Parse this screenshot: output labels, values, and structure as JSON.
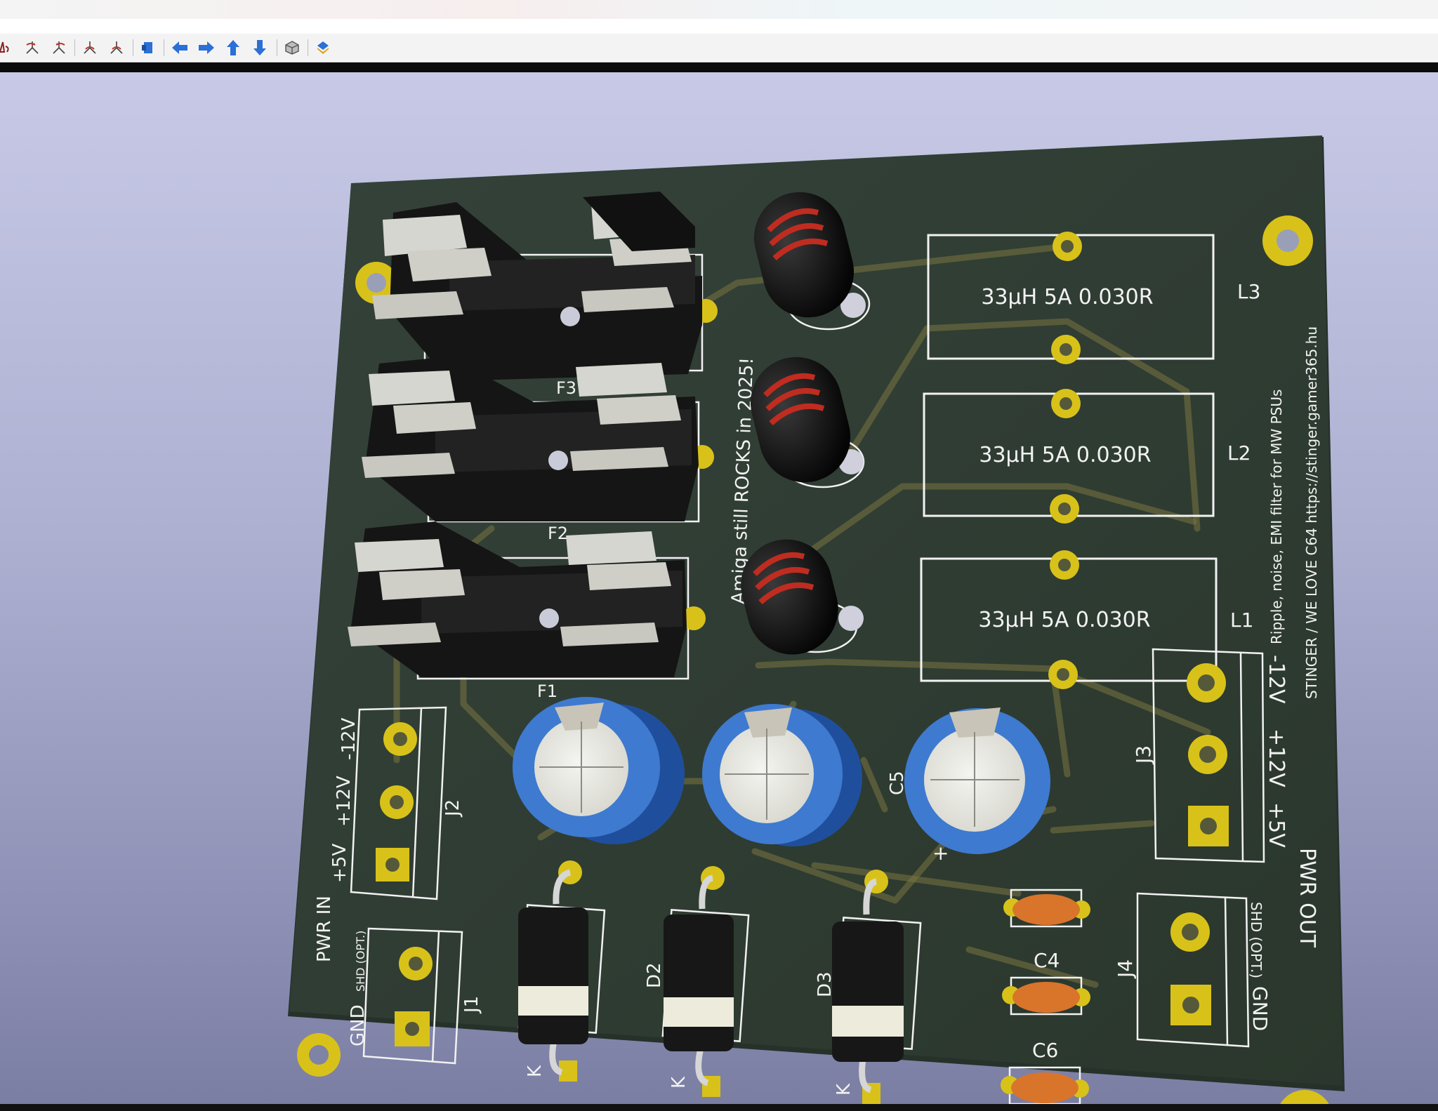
{
  "toolbar": {
    "icons": [
      "flip-board-icon",
      "rotate-x-ccw-icon",
      "rotate-x-cw-icon",
      "rotate-y-ccw-icon",
      "rotate-y-cw-icon",
      "rotate-z-icon",
      "move-left-icon",
      "move-right-icon",
      "move-up-icon",
      "move-down-icon",
      "board-body-icon",
      "solder-mask-icon"
    ]
  },
  "board": {
    "silk_amiga": "Amiga still ROCKS in 2025!",
    "silk_ripple": "Ripple, noise, EMI filter for MW PSUs",
    "silk_stinger": "STINGER / WE LOVE C64 https://stinger.gamer365.hu",
    "pwr_in": "PWR IN",
    "pwr_out": "PWR OUT",
    "j2_labels": [
      "+5V",
      "+12V",
      "-12V"
    ],
    "j3_labels": [
      "-12V",
      "+12V",
      "+5V"
    ],
    "j1_labels": [
      "GND",
      "SHD (OPT.)"
    ],
    "j4_labels": [
      "SHD (OPT.)",
      "GND"
    ],
    "inductor_value": "33µH 5A 0.030R",
    "refs": {
      "F1": "F1",
      "F2": "F2",
      "F3": "F3",
      "L1": "L1",
      "L2": "L2",
      "L3": "L3",
      "J1": "J1",
      "J2": "J2",
      "J3": "J3",
      "J4": "J4",
      "D2": "D2",
      "D3": "D3",
      "C4": "C4",
      "C5": "C5",
      "C6": "C6",
      "K": "K",
      "plus": "+"
    }
  },
  "colors": {
    "pcb": "#2f3d31",
    "silk": "#f2f2f2",
    "pad": "#d8c21a",
    "cap_blue": "#3e7ad0",
    "cap_small": "#d9742b",
    "toolbar_icon_blue": "#2a70d6",
    "toolbar_icon_red": "#c0392b"
  }
}
